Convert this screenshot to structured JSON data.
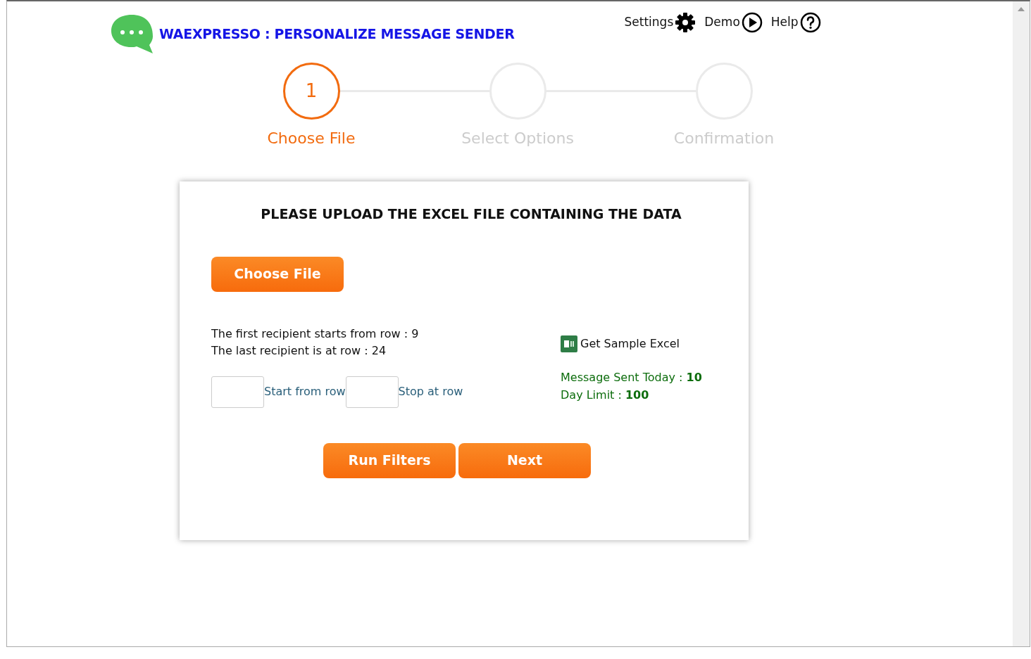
{
  "header": {
    "title": "WAEXPRESSO : PERSONALIZE MESSAGE SENDER",
    "links": [
      {
        "label": "Settings",
        "kind": "settings"
      },
      {
        "label": "Demo",
        "kind": "demo"
      },
      {
        "label": "Help",
        "kind": "help"
      }
    ]
  },
  "steps": [
    {
      "number": "1",
      "label": "Choose File",
      "selected": true
    },
    {
      "label": "Select Options",
      "selected": false
    },
    {
      "label": "Confirmation",
      "selected": false
    }
  ],
  "card": {
    "heading": "PLEASE UPLOAD THE EXCEL FILE CONTAINING THE DATA",
    "choose_button": "Choose File",
    "info": [
      "The first recipient starts from row : 9",
      "The last recipient is at row : 24"
    ],
    "fields": [
      {
        "label": "Start from row"
      },
      {
        "label": "Stop at row"
      }
    ],
    "sample_link": "Get Sample Excel",
    "stats": [
      "Message Sent Today : **10**",
      "Day Limit : **100**"
    ],
    "buttons": [
      "Run Filters",
      "Next"
    ]
  }
}
